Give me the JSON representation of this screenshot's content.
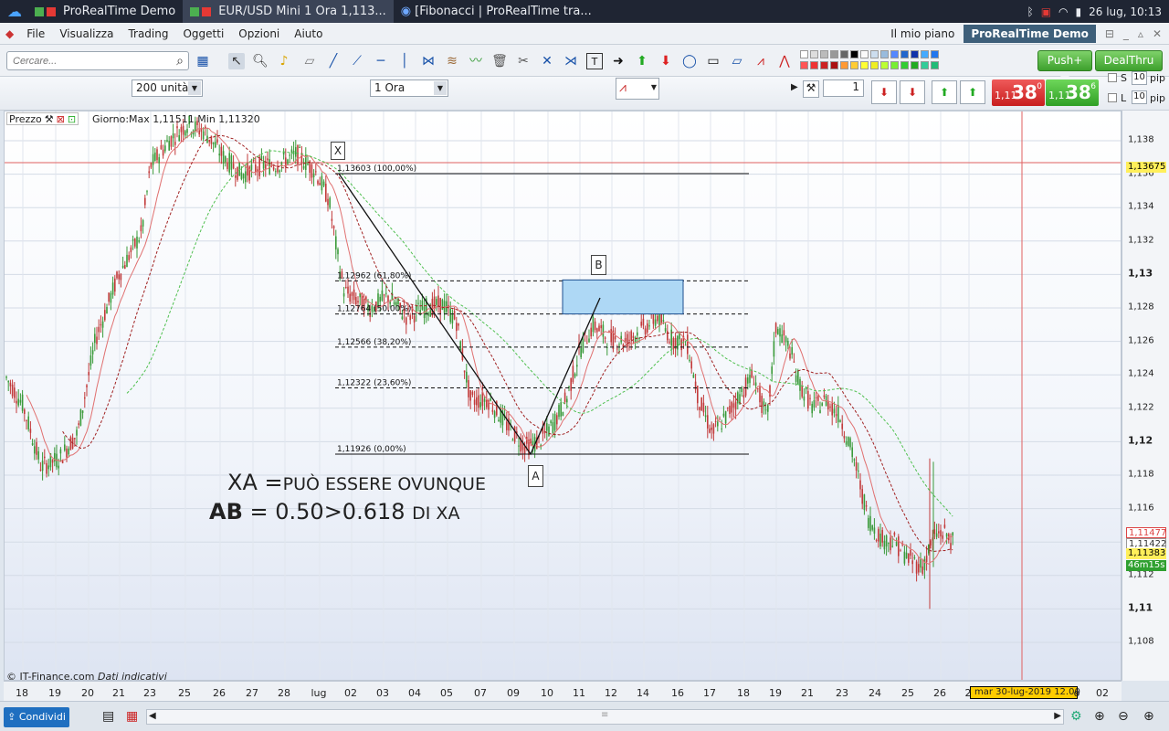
{
  "taskbar": {
    "apps": [
      {
        "label": "ProRealTime Demo",
        "active": false
      },
      {
        "label": "EUR/USD Mini   1 Ora   1,113...",
        "active": true
      },
      {
        "label": "[Fibonacci | ProRealTime tra...",
        "active": false
      }
    ],
    "clock": "26 lug, 10:13"
  },
  "menu": {
    "items": [
      "File",
      "Visualizza",
      "Trading",
      "Oggetti",
      "Opzioni",
      "Aiuto"
    ],
    "right_link": "Il mio piano",
    "brand": "ProRealTime Demo"
  },
  "toolbar": {
    "search_placeholder": "Cercare...",
    "push_label": "Push+",
    "dealthru_label": "DealThru"
  },
  "toolbar2": {
    "units_select": "200 unità",
    "timeframe_select": "1 Ora",
    "qty_value": "1",
    "sell_prefix": "1,11",
    "sell_big": "38",
    "sell_sup": "0",
    "buy_prefix": "1,11",
    "buy_big": "38",
    "buy_sup": "6",
    "s_label": "S",
    "l_label": "L",
    "s_pip_value": "10",
    "l_pip_value": "10",
    "pip_label": "pip"
  },
  "chart": {
    "header_label": "Prezzo",
    "header_info": "Giorno:Max 1,11511 Min 1,11320",
    "watermark": "© IT-Finance.com",
    "watermark_note": "Dati indicativi",
    "point_labels": {
      "X": "X",
      "A": "A",
      "B": "B"
    },
    "fib_levels": [
      {
        "label": "1,13603 (100,00%)",
        "price": 1.13603,
        "style": "solid"
      },
      {
        "label": "1,12962 (61,80%)",
        "price": 1.12962,
        "style": "dashed"
      },
      {
        "label": "1,12764 (50,00%)",
        "price": 1.12764,
        "style": "dashed"
      },
      {
        "label": "1,12566 (38,20%)",
        "price": 1.12566,
        "style": "dashed"
      },
      {
        "label": "1,12322 (23,60%)",
        "price": 1.12322,
        "style": "dashed"
      },
      {
        "label": "1,11926 (0,00%)",
        "price": 1.11926,
        "style": "solid"
      }
    ],
    "annotation_line1_a": "XA",
    "annotation_line1_b": "=",
    "annotation_line1_c": "PUÒ ESSERE OVUNQUE",
    "annotation_line2_a": "AB",
    "annotation_line2_b": "= 0.50>0.618",
    "annotation_line2_c": "DI XA",
    "price_axis": [
      {
        "label": "1,138",
        "bold": false
      },
      {
        "label": "1,136",
        "bold": false
      },
      {
        "label": "1,134",
        "bold": false
      },
      {
        "label": "1,132",
        "bold": false
      },
      {
        "label": "1,13",
        "bold": true
      },
      {
        "label": "1,128",
        "bold": false
      },
      {
        "label": "1,126",
        "bold": false
      },
      {
        "label": "1,124",
        "bold": false
      },
      {
        "label": "1,122",
        "bold": false
      },
      {
        "label": "1,12",
        "bold": true
      },
      {
        "label": "1,118",
        "bold": false
      },
      {
        "label": "1,116",
        "bold": false
      },
      {
        "label": "1,114",
        "bold": false
      },
      {
        "label": "1,112",
        "bold": false
      },
      {
        "label": "1,11",
        "bold": true
      },
      {
        "label": "1,108",
        "bold": false
      }
    ],
    "price_tags": {
      "crosshair": "1,13675",
      "ma1": "1,11477",
      "ma2": "1,11422",
      "last": "1,11383",
      "countdown": "46m15s"
    },
    "date_axis": [
      "18",
      "19",
      "20",
      "21",
      "23",
      "25",
      "26",
      "27",
      "28",
      "lug",
      "02",
      "03",
      "04",
      "05",
      "07",
      "09",
      "10",
      "11",
      "12",
      "14",
      "16",
      "17",
      "18",
      "19",
      "21",
      "23",
      "24",
      "25",
      "26",
      "2",
      "o",
      "02"
    ],
    "cursor_date": "mar 30-lug-2019 12.00"
  },
  "bottom": {
    "share_label": "Condividi"
  }
}
